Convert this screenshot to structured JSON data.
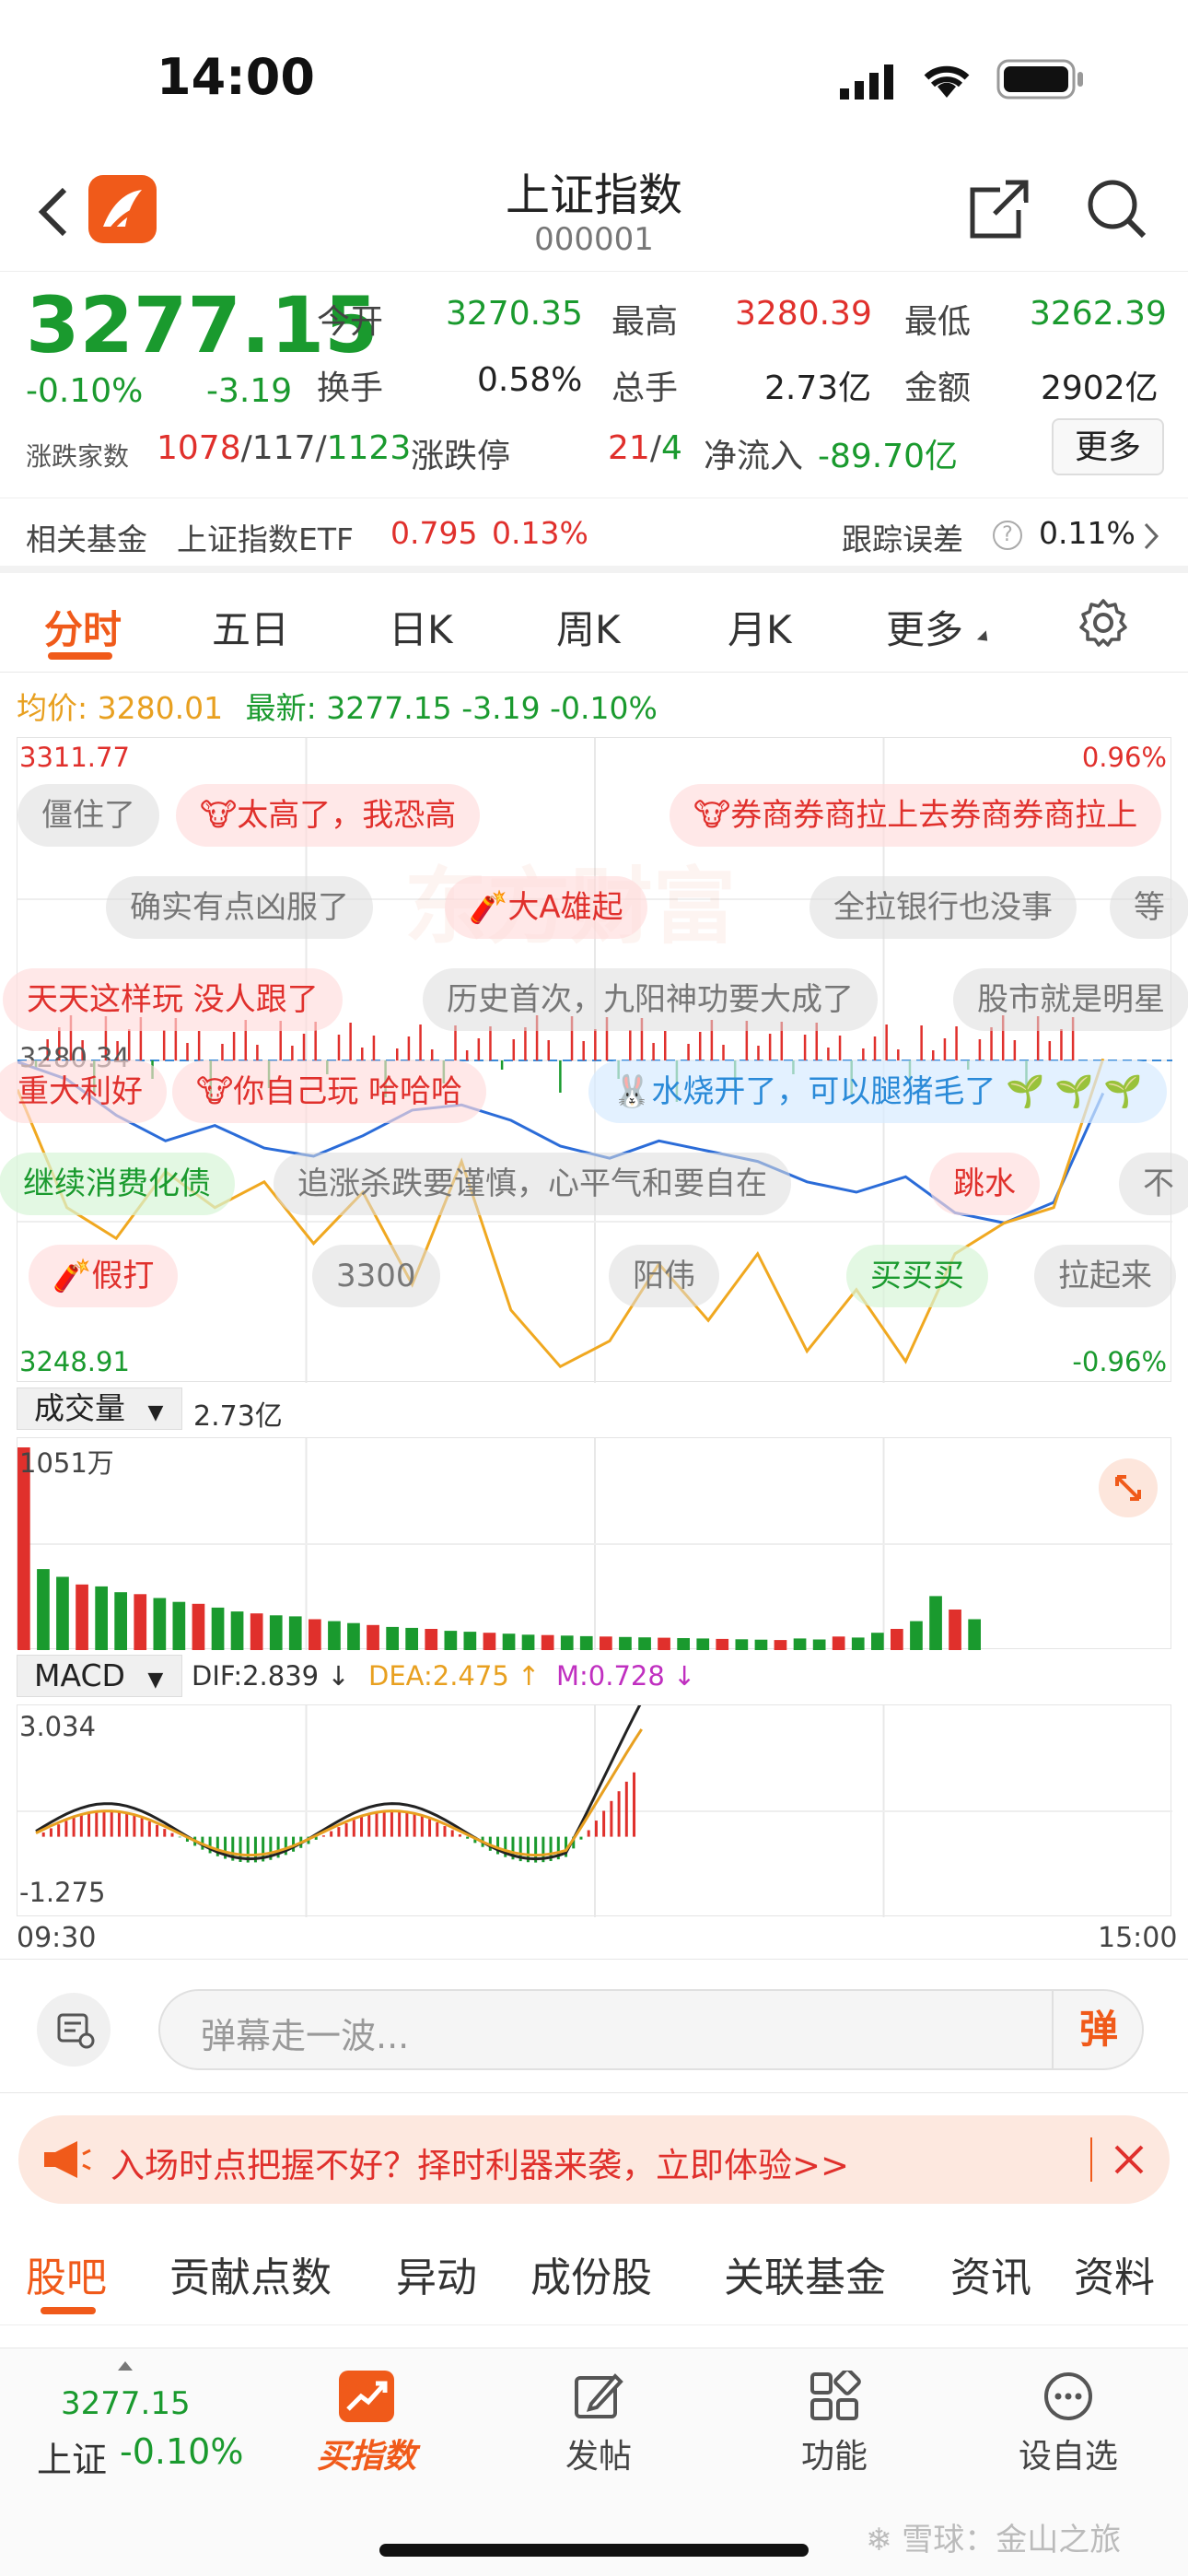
{
  "status_bar": {
    "time": "14:00"
  },
  "header": {
    "title": "上证指数",
    "code": "000001"
  },
  "quote": {
    "price": "3277.15",
    "change_pct": "-0.10%",
    "change": "-3.19",
    "open_label": "今开",
    "open": "3270.35",
    "high_label": "最高",
    "high": "3280.39",
    "low_label": "最低",
    "low": "3262.39",
    "turnover_label": "换手",
    "turnover": "0.58%",
    "volume_label": "总手",
    "volume": "2.73亿",
    "amount_label": "金额",
    "amount": "2902亿",
    "breadth_label": "涨跌家数",
    "up": "1078",
    "flat": "117",
    "down": "1123",
    "limit_label": "涨跌停",
    "limit_up": "21",
    "limit_down": "4",
    "netflow_label": "净流入",
    "netflow": "-89.70亿",
    "more_button": "更多"
  },
  "fund": {
    "label": "相关基金",
    "name": "上证指数ETF",
    "price": "0.795",
    "pct": "0.13%",
    "track_label": "跟踪误差",
    "track_value": "0.11%"
  },
  "tabs": [
    "分时",
    "五日",
    "日K",
    "周K",
    "月K",
    "更多"
  ],
  "avg": {
    "avg_label": "均价:",
    "avg_value": "3280.01",
    "latest_label": "最新:",
    "latest_value": "3277.15",
    "latest_change": "-3.19",
    "latest_pct": "-0.10%"
  },
  "chart_data": [
    {
      "type": "line",
      "title": "分时",
      "x_start": "09:30",
      "x_end": "15:00",
      "ylim": [
        3248.91,
        3311.77
      ],
      "y_top_label": "3311.77",
      "y_bottom_label": "3248.91",
      "y_mid_label": "3280.34",
      "pct_top_label": "0.96%",
      "pct_bottom_label": "-0.96%",
      "series": [
        {
          "name": "price",
          "color": "#2b6cd8",
          "values": [
            3280.2,
            3278.5,
            3275.0,
            3272.5,
            3274.0,
            3271.8,
            3271.0,
            3273.0,
            3275.5,
            3276.0,
            3274.5,
            3272.0,
            3270.8,
            3272.5,
            3271.5,
            3270.5,
            3268.5,
            3267.5,
            3269.0,
            3265.5,
            3264.5,
            3266.5,
            3277.15
          ]
        },
        {
          "name": "avg",
          "color": "#f0a820",
          "values": [
            3277.5,
            3266.0,
            3263.0,
            3269.5,
            3266.0,
            3268.5,
            3262.5,
            3267.5,
            3258.5,
            3270.5,
            3256.0,
            3250.5,
            3253.0,
            3260.5,
            3255.0,
            3261.5,
            3252.0,
            3258.0,
            3251.0,
            3261.5,
            3264.5,
            3266.0,
            3280.5
          ]
        }
      ]
    },
    {
      "type": "bar",
      "title": "成交量",
      "total": "2.73亿",
      "max_label": "1051万",
      "values": [
        1051,
        420,
        380,
        340,
        330,
        300,
        290,
        270,
        250,
        240,
        220,
        200,
        190,
        180,
        175,
        160,
        150,
        140,
        130,
        120,
        115,
        110,
        100,
        95,
        90,
        85,
        80,
        78,
        75,
        72,
        70,
        68,
        66,
        64,
        62,
        60,
        58,
        56,
        54,
        52,
        60,
        55,
        70,
        65,
        90,
        110,
        150,
        280,
        210,
        160
      ]
    },
    {
      "type": "line",
      "title": "MACD",
      "dif_label": "DIF:2.839",
      "dea_label": "DEA:2.475",
      "m_label": "M:0.728",
      "ylim": [
        -1.275,
        3.034
      ],
      "y_top_label": "3.034",
      "y_bottom_label": "-1.275"
    }
  ],
  "danmu": [
    "僵住了",
    "太高了，我恐高",
    "券商券商拉上去券商券商拉上",
    "确实有点凶服了",
    "大A雄起",
    "全拉银行也没事",
    "等",
    "天天这样玩 没人跟了",
    "历史首次，九阳神功要大成了",
    "股市就是明星",
    "重大利好",
    "你自己玩 哈哈哈",
    "水烧开了，可以腿猪毛了",
    "继续消费化债",
    "追涨杀跌要谨慎，心平气和要自在",
    "跳水",
    "不",
    "假打",
    "3300",
    "阳伟",
    "买买买",
    "拉起来"
  ],
  "danmu_input": {
    "placeholder": "弹幕走一波...",
    "send": "弹"
  },
  "ad": {
    "text": "入场时点把握不好？择时利器来袭，立即体验>>"
  },
  "bottom_tabs": [
    "股吧",
    "贡献点数",
    "异动",
    "成份股",
    "关联基金",
    "资讯",
    "资料"
  ],
  "bottom_bar": {
    "mini_price": "3277.15",
    "mini_name": "上证",
    "mini_pct": "-0.10%",
    "buy": "买指数",
    "post": "发帖",
    "func": "功能",
    "watch": "设自选"
  },
  "watermark": "雪球：金山之旅"
}
